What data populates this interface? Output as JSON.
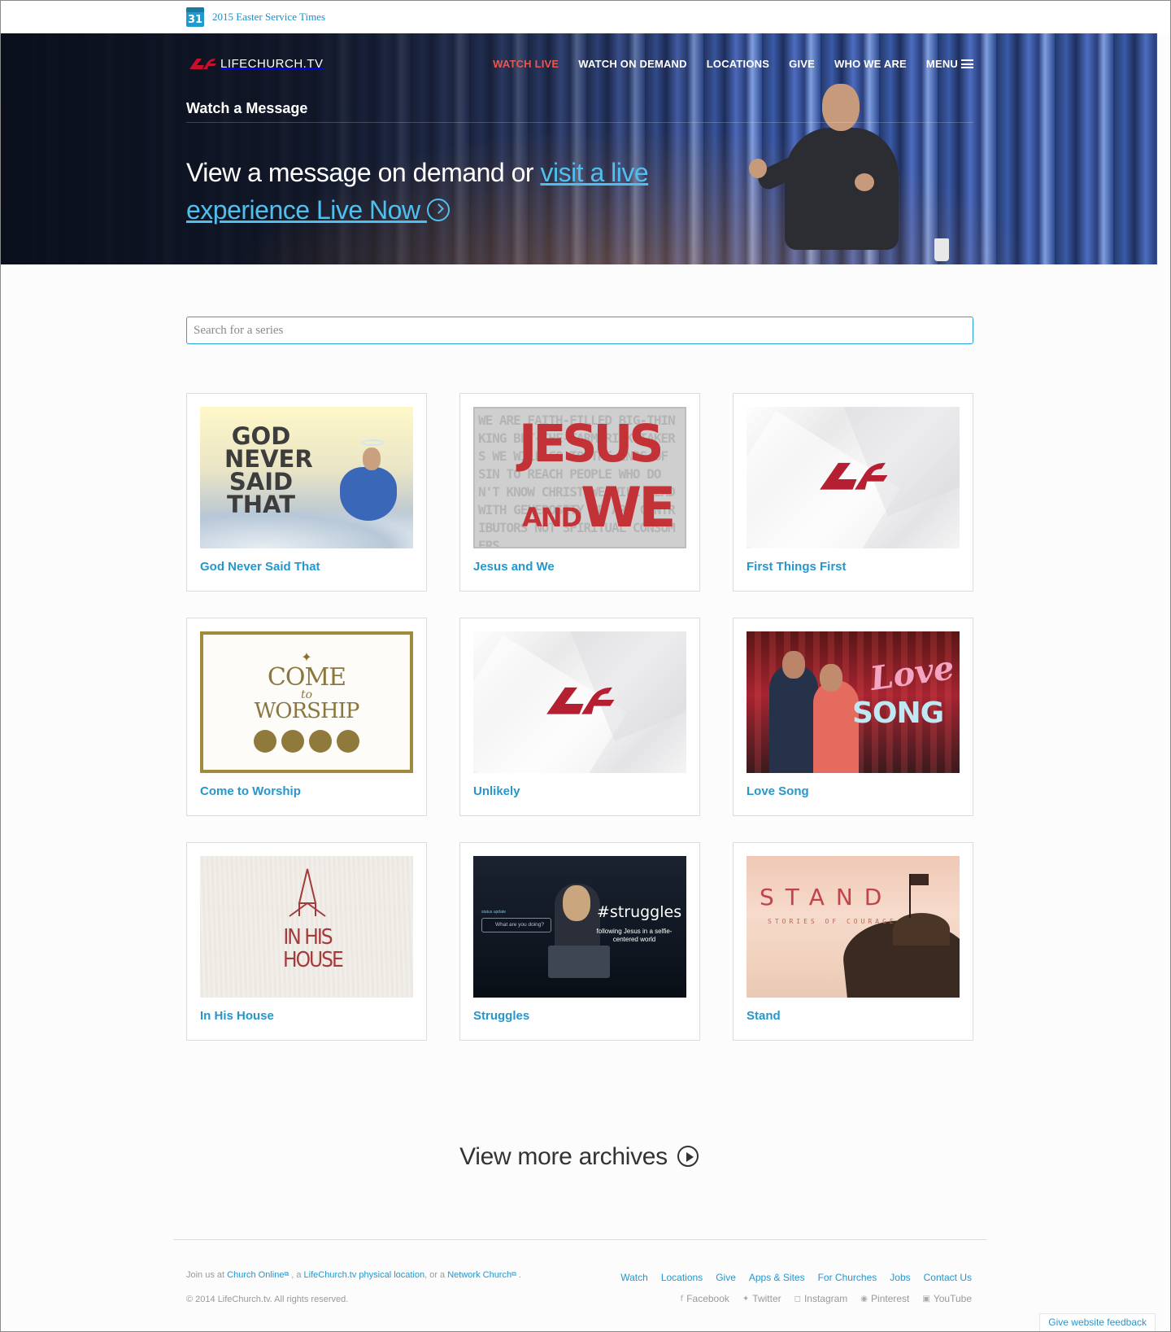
{
  "alert": {
    "icon": "calendar-icon",
    "date": "31",
    "text": "2015 Easter Service Times"
  },
  "brand": {
    "logo_icon": "lifechurch-logo-icon",
    "name": "LIFECHURCH.TV",
    "accent": "#c8102e"
  },
  "nav": {
    "items": [
      {
        "label": "WATCH LIVE",
        "active": true
      },
      {
        "label": "WATCH ON DEMAND",
        "active": false
      },
      {
        "label": "LOCATIONS",
        "active": false
      },
      {
        "label": "GIVE",
        "active": false
      },
      {
        "label": "WHO WE ARE",
        "active": false
      },
      {
        "label": "MENU",
        "active": false,
        "icon": "hamburger-icon"
      }
    ]
  },
  "hero": {
    "section_title": "Watch a Message",
    "headline_plain": "View a message on demand or ",
    "headline_link": "visit a live experience Live Now",
    "headline_link_icon": "play-circle-icon",
    "link_color": "#4fc0ee"
  },
  "search": {
    "placeholder": "Search for a series",
    "value": ""
  },
  "series": [
    {
      "title": "God Never Said That",
      "art_text": "GOD NEVER SAID THAT"
    },
    {
      "title": "Jesus and We",
      "art_text": "JESUS AND WE"
    },
    {
      "title": "First Things First"
    },
    {
      "title": "Come to Worship",
      "art_text": "COME to WORSHIP"
    },
    {
      "title": "Unlikely"
    },
    {
      "title": "Love Song",
      "art_text": "Love SONG"
    },
    {
      "title": "In His House",
      "art_text": "IN HIS HOUSE"
    },
    {
      "title": "Struggles",
      "art_text": "#struggles",
      "art_subtext": "following Jesus in a selfie-centered world",
      "art_bubble": "What are you doing?",
      "art_status": "status update"
    },
    {
      "title": "Stand",
      "art_text": "STAND",
      "art_subtext": "STORIES OF COURAGE"
    }
  ],
  "view_more": {
    "label": "View more archives",
    "icon": "play-circle-icon"
  },
  "footer": {
    "join_prefix": "Join us at ",
    "link1": "Church Online",
    "sep1": " , a ",
    "link2": "LifeChurch.tv physical location",
    "sep2": ", or a ",
    "link3": "Network Church",
    "suffix": " .",
    "copyright": "© 2014 LifeChurch.tv. All rights reserved.",
    "nav": [
      "Watch",
      "Locations",
      "Give",
      "Apps & Sites",
      "For Churches",
      "Jobs",
      "Contact Us"
    ],
    "social": [
      {
        "label": "Facebook",
        "icon": "facebook-icon"
      },
      {
        "label": "Twitter",
        "icon": "twitter-icon"
      },
      {
        "label": "Instagram",
        "icon": "instagram-icon"
      },
      {
        "label": "Pinterest",
        "icon": "pinterest-icon"
      },
      {
        "label": "YouTube",
        "icon": "youtube-icon"
      }
    ],
    "feedback": "Give website feedback",
    "link_color": "#2696cb"
  }
}
